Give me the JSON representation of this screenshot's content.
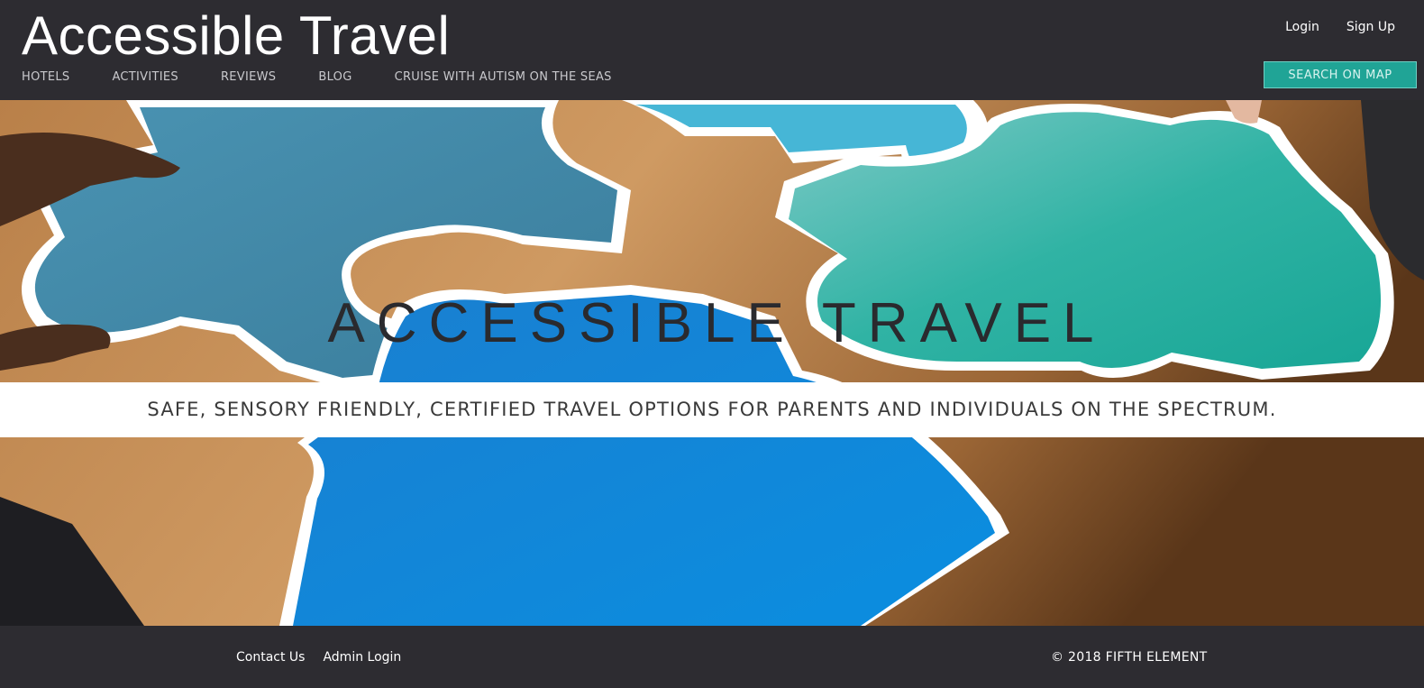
{
  "header": {
    "site_title": "Accessible Travel",
    "nav": [
      "HOTELS",
      "ACTIVITIES",
      "REVIEWS",
      "BLOG",
      "CRUISE WITH AUTISM ON THE SEAS"
    ],
    "login_label": "Login",
    "signup_label": "Sign Up",
    "search_map_label": "SEARCH ON MAP"
  },
  "hero": {
    "title": "ACCESSIBLE TRAVEL",
    "tagline": "SAFE, SENSORY FRIENDLY, CERTIFIED TRAVEL OPTIONS FOR PARENTS AND INDIVIDUALS ON THE SPECTRUM."
  },
  "footer": {
    "contact_label": "Contact Us",
    "admin_label": "Admin Login",
    "copyright": "© 2018 FIFTH ELEMENT"
  },
  "colors": {
    "header_bg": "#2d2c31",
    "accent_teal": "#20a496",
    "puzzle_blue_dark": "#3f86a3",
    "puzzle_blue_light": "#3fb3d3",
    "puzzle_teal": "#27b7a6",
    "puzzle_blue_bright": "#0a86d8"
  }
}
